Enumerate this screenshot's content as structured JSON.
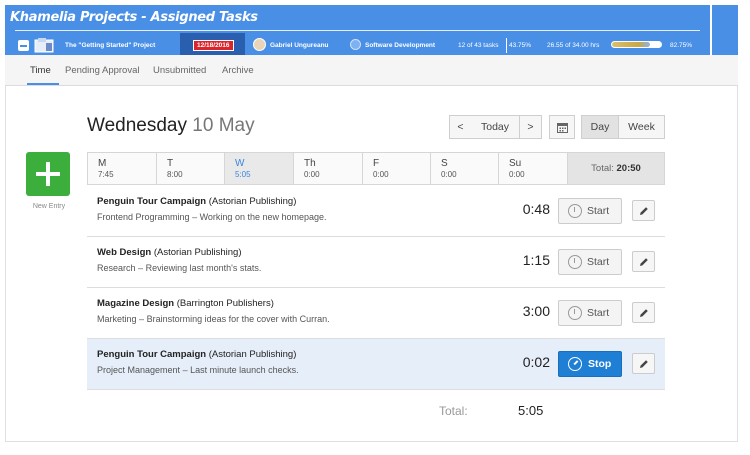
{
  "app": {
    "title": "Khamelia Projects - Assigned Tasks"
  },
  "infobar": {
    "project": "The \"Getting Started\" Project",
    "date": "12/18/2016",
    "user": "Gabriel Ungureanu",
    "department": "Software Development",
    "tasks": "12 of 43 tasks",
    "tasks_pct": "43.75%",
    "hours": "26.55 of 34.00 hrs",
    "hours_progress": 0.78,
    "hours_pct": "82.75%"
  },
  "tabs": [
    {
      "label": "Time",
      "active": true
    },
    {
      "label": "Pending Approval"
    },
    {
      "label": "Unsubmitted"
    },
    {
      "label": "Archive"
    }
  ],
  "header": {
    "weekday": "Wednesday",
    "date": "10 May"
  },
  "nav": {
    "prev": "<",
    "today": "Today",
    "next": ">",
    "day": "Day",
    "week": "Week"
  },
  "new_entry": {
    "label": "New Entry"
  },
  "week": {
    "days": [
      {
        "name": "M",
        "time": "7:45"
      },
      {
        "name": "T",
        "time": "8:00"
      },
      {
        "name": "W",
        "time": "5:05",
        "active": true
      },
      {
        "name": "Th",
        "time": "0:00"
      },
      {
        "name": "F",
        "time": "0:00"
      },
      {
        "name": "S",
        "time": "0:00"
      },
      {
        "name": "Su",
        "time": "0:00"
      }
    ],
    "total_label": "Total:",
    "total_value": "20:50"
  },
  "entries": [
    {
      "project": "Penguin Tour Campaign",
      "client": "(Astorian Publishing)",
      "task": "Frontend Programming",
      "note": "Working on the new homepage.",
      "duration": "0:48",
      "action": "Start"
    },
    {
      "project": "Web Design",
      "client": "(Astorian Publishing)",
      "task": "Research",
      "note": "Reviewing last month's stats.",
      "duration": "1:15",
      "action": "Start"
    },
    {
      "project": "Magazine Design",
      "client": "(Barrington Publishers)",
      "task": "Marketing",
      "note": "Brainstorming ideas for the cover with Curran.",
      "duration": "3:00",
      "action": "Start"
    },
    {
      "project": "Penguin Tour Campaign",
      "client": "(Astorian Publishing)",
      "task": "Project Management",
      "note": "Last minute launch checks.",
      "duration": "0:02",
      "action": "Stop",
      "running": true
    }
  ],
  "separator": "–",
  "footer": {
    "total_label": "Total:",
    "total_value": "5:05"
  }
}
